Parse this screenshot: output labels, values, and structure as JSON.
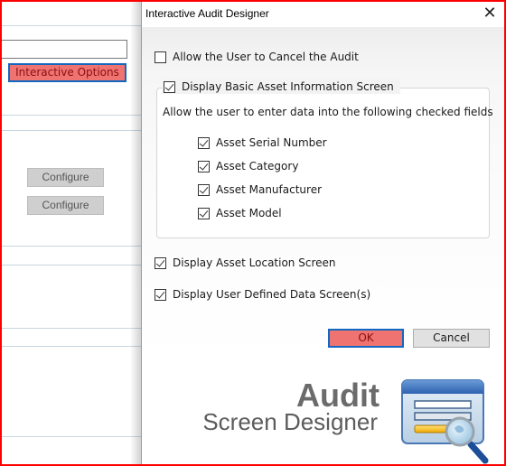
{
  "background_app": {
    "interactive_options_label": "Interactive Options",
    "configure_buttons": [
      {
        "label": "Configure"
      },
      {
        "label": "Configure"
      }
    ],
    "input_value": ""
  },
  "dialog": {
    "title": "Interactive Audit Designer",
    "close_icon": "close-icon",
    "options": {
      "allow_cancel": {
        "label": "Allow the User to Cancel the Audit",
        "checked": false
      },
      "display_basic": {
        "label": "Display Basic Asset Information Screen",
        "checked": true
      },
      "group_hint": "Allow the user to enter data into the following checked fields",
      "fields": [
        {
          "label": "Asset Serial Number",
          "checked": true
        },
        {
          "label": "Asset Category",
          "checked": true
        },
        {
          "label": "Asset Manufacturer",
          "checked": true
        },
        {
          "label": "Asset Model",
          "checked": true
        }
      ],
      "display_location": {
        "label": "Display Asset Location Screen",
        "checked": true
      },
      "display_user_defined": {
        "label": "Display User Defined Data Screen(s)",
        "checked": true
      }
    },
    "buttons": {
      "ok": "OK",
      "cancel": "Cancel"
    },
    "branding": {
      "title": "Audit",
      "subtitle": "Screen Designer",
      "icon": "screen-designer-magnifier-icon"
    }
  },
  "colors": {
    "highlight_button_bg": "#ef7370",
    "highlight_button_border": "#1467c0",
    "highlight_button_text": "#8c0e13",
    "frame_border": "#ff0000"
  }
}
